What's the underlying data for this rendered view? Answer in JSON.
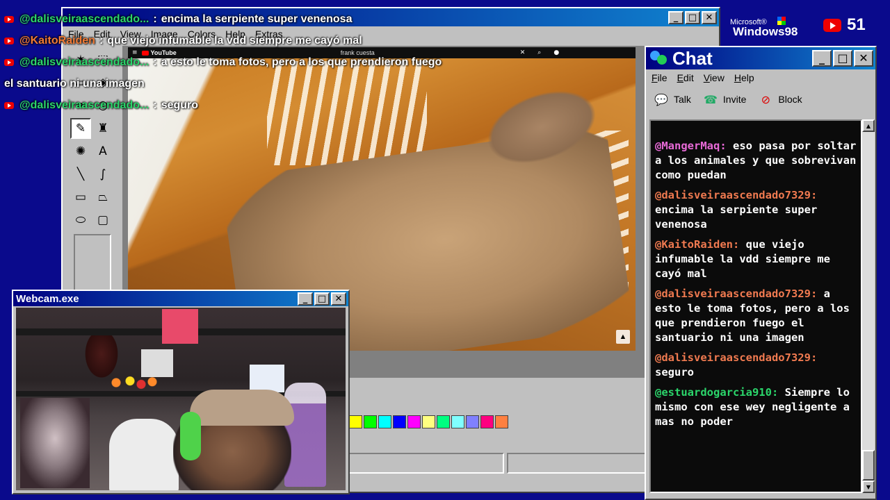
{
  "paint": {
    "menu": [
      "File",
      "Edit",
      "View",
      "Image",
      "Colors",
      "Help",
      "Extras"
    ],
    "tools": [
      {
        "icon": "free-select-icon",
        "glyph": "✶"
      },
      {
        "icon": "rect-select-icon",
        "glyph": "⬚"
      },
      {
        "icon": "eraser-icon",
        "glyph": "▱"
      },
      {
        "icon": "fill-icon",
        "glyph": "◈"
      },
      {
        "icon": "picker-icon",
        "glyph": "✒"
      },
      {
        "icon": "magnifier-icon",
        "glyph": "○"
      },
      {
        "icon": "pencil-icon",
        "glyph": "✎"
      },
      {
        "icon": "brush-icon",
        "glyph": "♜"
      },
      {
        "icon": "airbrush-icon",
        "glyph": "✺"
      },
      {
        "icon": "text-icon",
        "glyph": "A"
      },
      {
        "icon": "line-icon",
        "glyph": "╲"
      },
      {
        "icon": "curve-icon",
        "glyph": "∫"
      },
      {
        "icon": "rectangle-icon",
        "glyph": "▭"
      },
      {
        "icon": "polygon-icon",
        "glyph": "⏢"
      },
      {
        "icon": "ellipse-icon",
        "glyph": "⬭"
      },
      {
        "icon": "rounded-rect-icon",
        "glyph": "▢"
      }
    ],
    "palette": [
      "#ffff00",
      "#00ff00",
      "#00ffff",
      "#0000ff",
      "#ff00ff",
      "#ffff80",
      "#00ff80",
      "#80ffff",
      "#8080ff",
      "#ff0080",
      "#ff8040"
    ]
  },
  "video": {
    "site": "YouTube",
    "search": "frank cuesta"
  },
  "overlay_chat": [
    {
      "user": "@dalisveiraascendado...",
      "color": "green",
      "text": "encima la serpiente super venenosa"
    },
    {
      "user": "@KaitoRaiden",
      "color": "orange",
      "text": "que viejo infumable la vdd siempre me cayó mal"
    },
    {
      "user": "@dalisveiraascendado...",
      "color": "green",
      "text": "a esto le toma fotos, pero a los que prendieron fuego"
    },
    {
      "continuation": "el santuario ni una imagen"
    },
    {
      "user": "@dalisveiraascendado...",
      "color": "green",
      "text": "seguro"
    }
  ],
  "branding": {
    "microsoft": "Microsoft®",
    "windows": "Windows98"
  },
  "viewers": "51",
  "chat": {
    "title": "Chat",
    "menu": [
      "File",
      "Edit",
      "View",
      "Help"
    ],
    "toolbar": [
      {
        "label": "Talk",
        "icon": "talk-icon"
      },
      {
        "label": "Invite",
        "icon": "invite-icon"
      },
      {
        "label": "Block",
        "icon": "block-icon"
      }
    ],
    "messages": [
      {
        "user": "@MangerMaq:",
        "color": "pink",
        "text": "eso pasa por soltar a los animales y que sobrevivan como puedan"
      },
      {
        "user": "@dalisveiraascendado7329:",
        "color": "orange",
        "text": "encima la serpiente super venenosa"
      },
      {
        "user": "@KaitoRaiden:",
        "color": "orange",
        "text": "que viejo infumable la vdd siempre me cayó mal"
      },
      {
        "user": "@dalisveiraascendado7329:",
        "color": "orange",
        "text": "a esto le toma fotos, pero a los que prendieron fuego el santuario ni una imagen"
      },
      {
        "user": "@dalisveiraascendado7329:",
        "color": "orange",
        "text": "seguro"
      },
      {
        "user": "@estuardogarcia910:",
        "color": "green",
        "text": "Siempre lo mismo con ese wey negligente a mas no poder"
      }
    ]
  },
  "webcam": {
    "title": "Webcam.exe"
  }
}
